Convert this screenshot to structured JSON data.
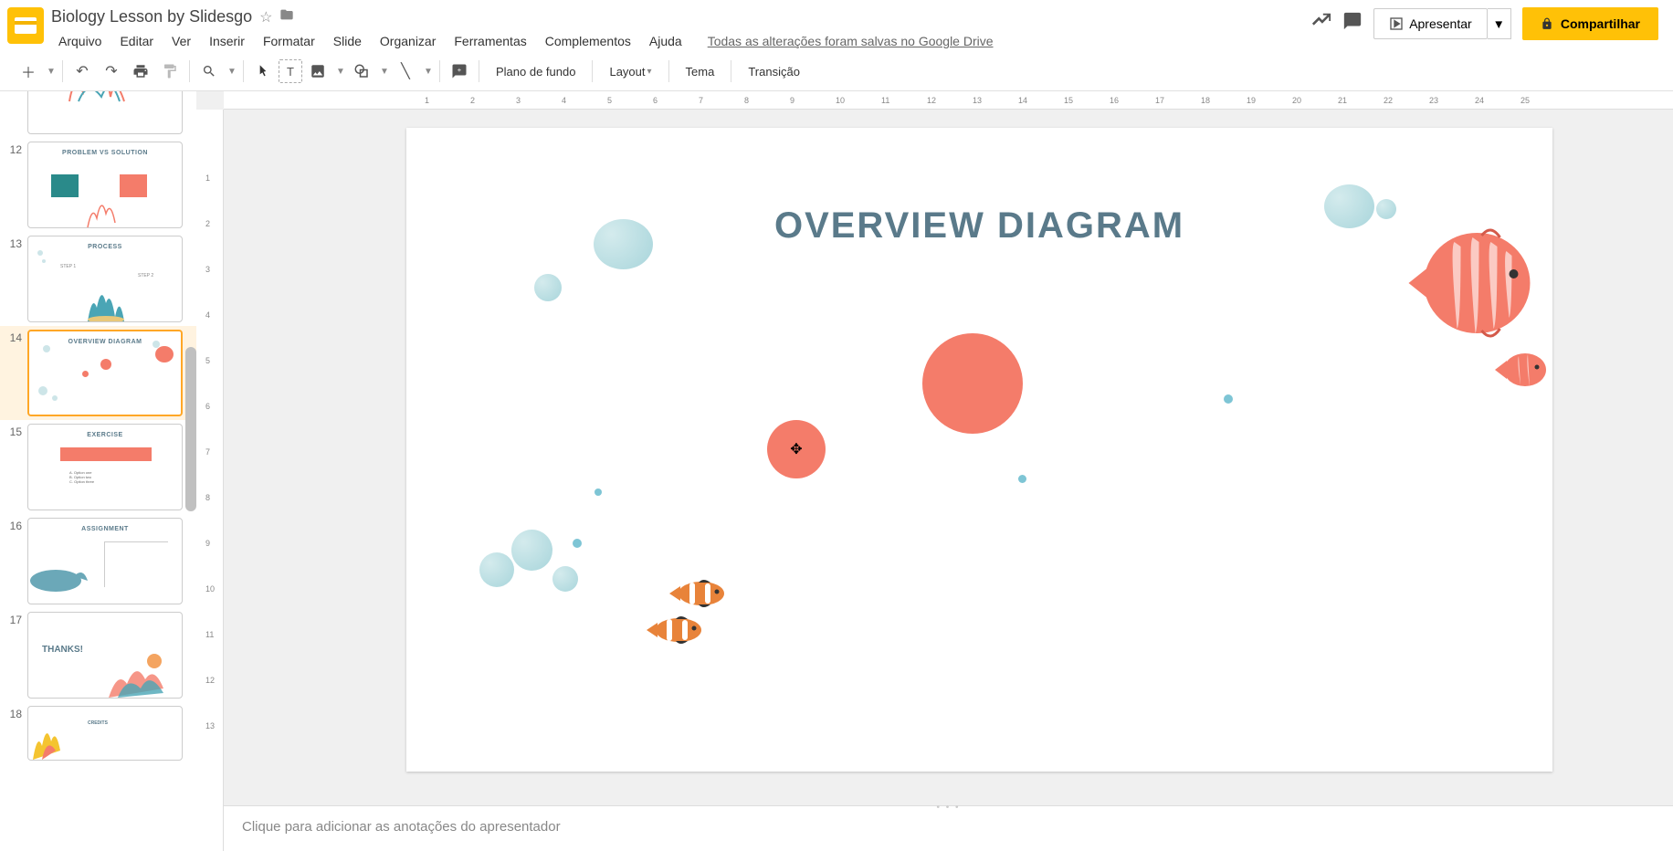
{
  "document": {
    "title": "Biology Lesson by Slidesgo"
  },
  "menubar": {
    "file": "Arquivo",
    "edit": "Editar",
    "view": "Ver",
    "insert": "Inserir",
    "format": "Formatar",
    "slide": "Slide",
    "arrange": "Organizar",
    "tools": "Ferramentas",
    "addons": "Complementos",
    "help": "Ajuda",
    "save_status": "Todas as alterações foram salvas no Google Drive"
  },
  "header_buttons": {
    "present": "Apresentar",
    "share": "Compartilhar"
  },
  "toolbar": {
    "background": "Plano de fundo",
    "layout": "Layout",
    "theme": "Tema",
    "transition": "Transição"
  },
  "ruler_h": [
    "1",
    "2",
    "3",
    "4",
    "5",
    "6",
    "7",
    "8",
    "9",
    "10",
    "11",
    "12",
    "13",
    "14",
    "15",
    "16",
    "17",
    "18",
    "19",
    "20",
    "21",
    "22",
    "23",
    "24",
    "25"
  ],
  "ruler_v": [
    "1",
    "2",
    "3",
    "4",
    "5",
    "6",
    "7",
    "8",
    "9",
    "10",
    "11",
    "12",
    "13"
  ],
  "slides": {
    "n12": "12",
    "t12": "PROBLEM VS SOLUTION",
    "n13": "13",
    "t13": "PROCESS",
    "n14": "14",
    "t14": "OVERVIEW DIAGRAM",
    "n15": "15",
    "t15": "EXERCISE",
    "n16": "16",
    "t16": "ASSIGNMENT",
    "n17": "17",
    "t17": "THANKS!",
    "n18": "18",
    "t18": "CREDITS"
  },
  "main_slide": {
    "heading": "OVERVIEW DIAGRAM"
  },
  "notes": {
    "placeholder": "Clique para adicionar as anotações do apresentador"
  }
}
